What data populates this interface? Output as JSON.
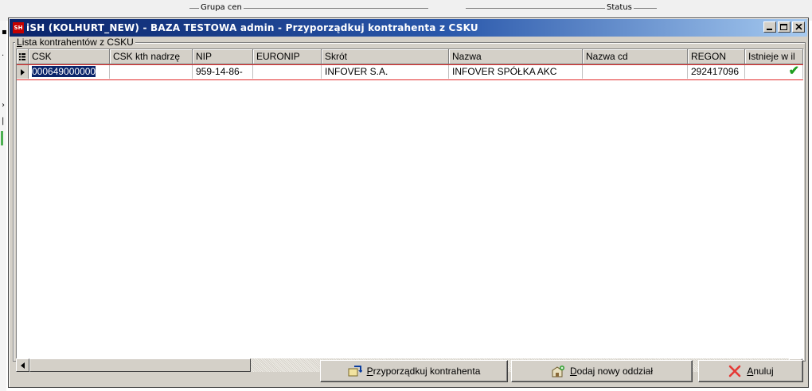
{
  "window": {
    "title": "iSH (KOLHURT_NEW) - BAZA TESTOWA  admin - Przyporządkuj kontrahenta z CSKU",
    "app_icon_text": "SH"
  },
  "background": {
    "group_label": "Grupa cen",
    "status_label": "Status"
  },
  "group": {
    "label_first": "L",
    "label_rest": "ista kontrahentów z CSKU"
  },
  "grid": {
    "columns": [
      {
        "key": "csk",
        "label": "CSK"
      },
      {
        "key": "csk_kth",
        "label": "CSK kth nadrzę"
      },
      {
        "key": "nip",
        "label": "NIP"
      },
      {
        "key": "euronip",
        "label": "EURONIP"
      },
      {
        "key": "skrot",
        "label": "Skrót"
      },
      {
        "key": "nazwa",
        "label": "Nazwa"
      },
      {
        "key": "nazwa_cd",
        "label": "Nazwa cd"
      },
      {
        "key": "regon",
        "label": "REGON"
      },
      {
        "key": "istnieje",
        "label": "Istnieje w il"
      }
    ],
    "rows": [
      {
        "csk": "000649000000",
        "csk_kth": "",
        "nip": "959-14-86-",
        "euronip": "",
        "skrot": "INFOVER S.A.",
        "nazwa": "INFOVER  SPÓŁKA AKC",
        "nazwa_cd": "",
        "regon": "292417096",
        "istnieje": "✔"
      }
    ]
  },
  "buttons": {
    "assign": {
      "underline": "P",
      "rest": "rzyporządkuj kontrahenta"
    },
    "add": {
      "underline": "D",
      "rest": "odaj nowy oddział"
    },
    "cancel": {
      "underline": "A",
      "rest": "nuluj"
    }
  },
  "colors": {
    "title_start": "#0a246a",
    "title_end": "#a6caf0",
    "row_border": "#e32b2b",
    "selected_bg": "#0a246a",
    "check": "#1e9e1e",
    "cancel_x": "#e53935"
  }
}
